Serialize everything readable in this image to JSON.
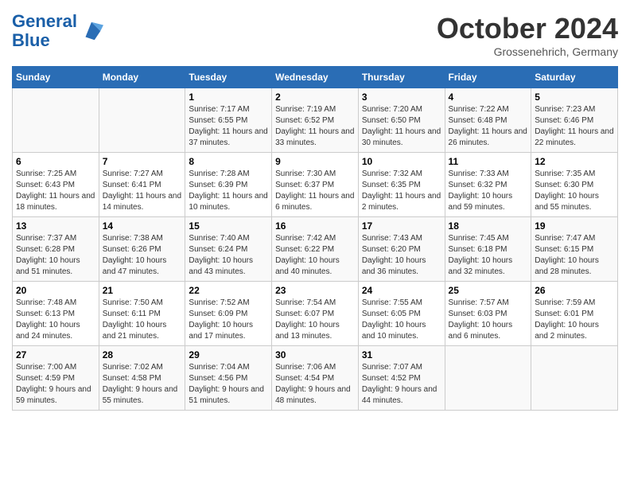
{
  "header": {
    "logo_line1": "General",
    "logo_line2": "Blue",
    "month_title": "October 2024",
    "location": "Grossenehrich, Germany"
  },
  "weekdays": [
    "Sunday",
    "Monday",
    "Tuesday",
    "Wednesday",
    "Thursday",
    "Friday",
    "Saturday"
  ],
  "weeks": [
    [
      {
        "day": "",
        "info": ""
      },
      {
        "day": "",
        "info": ""
      },
      {
        "day": "1",
        "info": "Sunrise: 7:17 AM\nSunset: 6:55 PM\nDaylight: 11 hours and 37 minutes."
      },
      {
        "day": "2",
        "info": "Sunrise: 7:19 AM\nSunset: 6:52 PM\nDaylight: 11 hours and 33 minutes."
      },
      {
        "day": "3",
        "info": "Sunrise: 7:20 AM\nSunset: 6:50 PM\nDaylight: 11 hours and 30 minutes."
      },
      {
        "day": "4",
        "info": "Sunrise: 7:22 AM\nSunset: 6:48 PM\nDaylight: 11 hours and 26 minutes."
      },
      {
        "day": "5",
        "info": "Sunrise: 7:23 AM\nSunset: 6:46 PM\nDaylight: 11 hours and 22 minutes."
      }
    ],
    [
      {
        "day": "6",
        "info": "Sunrise: 7:25 AM\nSunset: 6:43 PM\nDaylight: 11 hours and 18 minutes."
      },
      {
        "day": "7",
        "info": "Sunrise: 7:27 AM\nSunset: 6:41 PM\nDaylight: 11 hours and 14 minutes."
      },
      {
        "day": "8",
        "info": "Sunrise: 7:28 AM\nSunset: 6:39 PM\nDaylight: 11 hours and 10 minutes."
      },
      {
        "day": "9",
        "info": "Sunrise: 7:30 AM\nSunset: 6:37 PM\nDaylight: 11 hours and 6 minutes."
      },
      {
        "day": "10",
        "info": "Sunrise: 7:32 AM\nSunset: 6:35 PM\nDaylight: 11 hours and 2 minutes."
      },
      {
        "day": "11",
        "info": "Sunrise: 7:33 AM\nSunset: 6:32 PM\nDaylight: 10 hours and 59 minutes."
      },
      {
        "day": "12",
        "info": "Sunrise: 7:35 AM\nSunset: 6:30 PM\nDaylight: 10 hours and 55 minutes."
      }
    ],
    [
      {
        "day": "13",
        "info": "Sunrise: 7:37 AM\nSunset: 6:28 PM\nDaylight: 10 hours and 51 minutes."
      },
      {
        "day": "14",
        "info": "Sunrise: 7:38 AM\nSunset: 6:26 PM\nDaylight: 10 hours and 47 minutes."
      },
      {
        "day": "15",
        "info": "Sunrise: 7:40 AM\nSunset: 6:24 PM\nDaylight: 10 hours and 43 minutes."
      },
      {
        "day": "16",
        "info": "Sunrise: 7:42 AM\nSunset: 6:22 PM\nDaylight: 10 hours and 40 minutes."
      },
      {
        "day": "17",
        "info": "Sunrise: 7:43 AM\nSunset: 6:20 PM\nDaylight: 10 hours and 36 minutes."
      },
      {
        "day": "18",
        "info": "Sunrise: 7:45 AM\nSunset: 6:18 PM\nDaylight: 10 hours and 32 minutes."
      },
      {
        "day": "19",
        "info": "Sunrise: 7:47 AM\nSunset: 6:15 PM\nDaylight: 10 hours and 28 minutes."
      }
    ],
    [
      {
        "day": "20",
        "info": "Sunrise: 7:48 AM\nSunset: 6:13 PM\nDaylight: 10 hours and 24 minutes."
      },
      {
        "day": "21",
        "info": "Sunrise: 7:50 AM\nSunset: 6:11 PM\nDaylight: 10 hours and 21 minutes."
      },
      {
        "day": "22",
        "info": "Sunrise: 7:52 AM\nSunset: 6:09 PM\nDaylight: 10 hours and 17 minutes."
      },
      {
        "day": "23",
        "info": "Sunrise: 7:54 AM\nSunset: 6:07 PM\nDaylight: 10 hours and 13 minutes."
      },
      {
        "day": "24",
        "info": "Sunrise: 7:55 AM\nSunset: 6:05 PM\nDaylight: 10 hours and 10 minutes."
      },
      {
        "day": "25",
        "info": "Sunrise: 7:57 AM\nSunset: 6:03 PM\nDaylight: 10 hours and 6 minutes."
      },
      {
        "day": "26",
        "info": "Sunrise: 7:59 AM\nSunset: 6:01 PM\nDaylight: 10 hours and 2 minutes."
      }
    ],
    [
      {
        "day": "27",
        "info": "Sunrise: 7:00 AM\nSunset: 4:59 PM\nDaylight: 9 hours and 59 minutes."
      },
      {
        "day": "28",
        "info": "Sunrise: 7:02 AM\nSunset: 4:58 PM\nDaylight: 9 hours and 55 minutes."
      },
      {
        "day": "29",
        "info": "Sunrise: 7:04 AM\nSunset: 4:56 PM\nDaylight: 9 hours and 51 minutes."
      },
      {
        "day": "30",
        "info": "Sunrise: 7:06 AM\nSunset: 4:54 PM\nDaylight: 9 hours and 48 minutes."
      },
      {
        "day": "31",
        "info": "Sunrise: 7:07 AM\nSunset: 4:52 PM\nDaylight: 9 hours and 44 minutes."
      },
      {
        "day": "",
        "info": ""
      },
      {
        "day": "",
        "info": ""
      }
    ]
  ]
}
